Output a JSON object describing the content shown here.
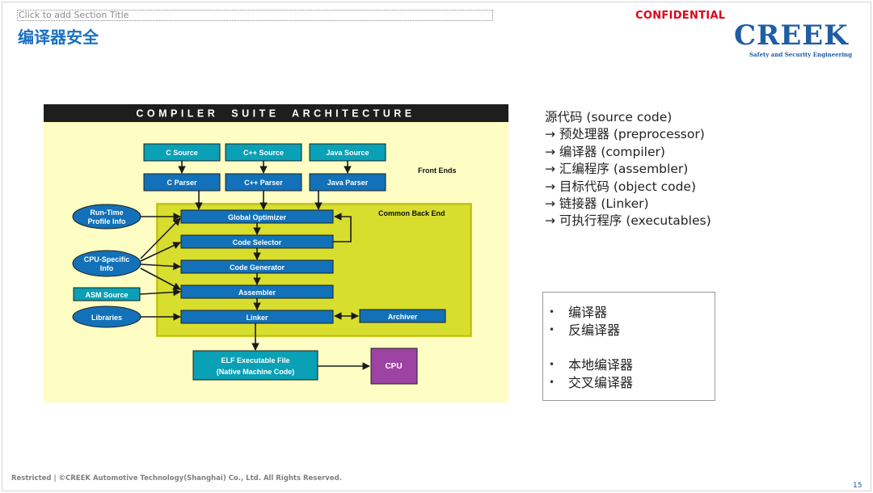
{
  "slide": {
    "section_placeholder": "Click to add Section Title",
    "title": "编译器安全",
    "confidential": "CONFIDENTIAL",
    "logo": "CREEK",
    "logo_tagline": "Safety and Security Engineering",
    "footer": "Restricted | ©CREEK Automotive Technology(Shanghai) Co., Ltd. All Rights Reserved.",
    "page_number": "15"
  },
  "diagram": {
    "banner": "COMPILER  SUITE  ARCHITECTURE",
    "front_ends_label": "Front Ends",
    "back_end_label": "Common Back End",
    "sources": [
      "C Source",
      "C++ Source",
      "Java Source"
    ],
    "parsers": [
      "C Parser",
      "C++ Parser",
      "Java Parser"
    ],
    "inputs": {
      "runtime": [
        "Run-Time",
        "Profile Info"
      ],
      "cpu_specific": [
        "CPU-Specific",
        "Info"
      ],
      "asm_source": "ASM Source",
      "libraries": "Libraries"
    },
    "stages": [
      "Global Optimizer",
      "Code Selector",
      "Code Generator",
      "Assembler",
      "Linker"
    ],
    "archiver": "Archiver",
    "elf": [
      "ELF Executable File",
      "(Native Machine Code)"
    ],
    "cpu": "CPU",
    "colors": {
      "yellow": "#d8de2e",
      "teal": "#0aa0b5",
      "blue": "#1271b8",
      "purple": "#9c43a3",
      "panel": "#fefec4"
    }
  },
  "steps": [
    "源代码 (source code)",
    "→ 预处理器 (preprocessor)",
    "→ 编译器 (compiler)",
    "→ 汇编程序 (assembler)",
    "→ 目标代码 (object code)",
    "→ 链接器 (Linker)",
    "→ 可执行程序 (executables)"
  ],
  "bullets": [
    "编译器",
    "反编译器",
    "本地编译器",
    "交叉编译器"
  ]
}
